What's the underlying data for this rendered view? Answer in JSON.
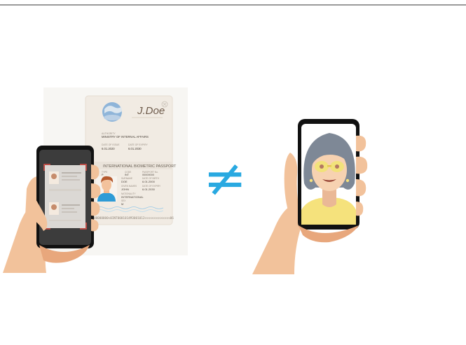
{
  "passport": {
    "header": "INTERNATIONAL BIOMETRIC PASSPORT",
    "authority_label": "AUTHORITY",
    "authority_value": "MINISTRY OF INTERNAL AFFAIRS",
    "issue_label": "DATE OF ISSUE",
    "issue_value": "6.01.2020",
    "expiry_label": "DATE OF EXPIRY",
    "expiry_value": "6.01.2030",
    "type_label": "TYPE",
    "type_value": "P",
    "code_label": "CODE",
    "code_value": "INT",
    "number_label": "PASSPORT No.",
    "number_value": "00000000",
    "surname_label": "SURNAME",
    "surname_value": "DOE",
    "given_label": "GIVEN NAMES",
    "given_value": "JOHN",
    "nationality_label": "NATIONALITY",
    "nationality_value": "INTERNATIONAL",
    "dob_label": "DATE OF BIRTH",
    "dob_value": "6.01.2000",
    "sex_label": "SEX",
    "sex_value": "M",
    "mrz_line": "P<INTDOE<<JOHN<<<<<<<<<<<<<<<<<<<<<<<<<<<<<<<<",
    "mrz_line2": "00000000<0INT0001014M3001012<<<<<<<<<<<<<<06",
    "signature": "J.Doe"
  },
  "symbols": {
    "not_equal": "≠"
  },
  "colors": {
    "skin": "#f2c29b",
    "skin_shadow": "#e8a77c",
    "phone_body": "#111111",
    "phone_screen_dark": "#3c3c3c",
    "scan_corner": "#e0524a",
    "not_equal_color": "#29a9e1",
    "hair": "#7e8896",
    "face": "#f7d2b1",
    "glasses": "#f2e27a",
    "shirt": "#f5e27c",
    "selfie_bg": "#ffffff"
  }
}
